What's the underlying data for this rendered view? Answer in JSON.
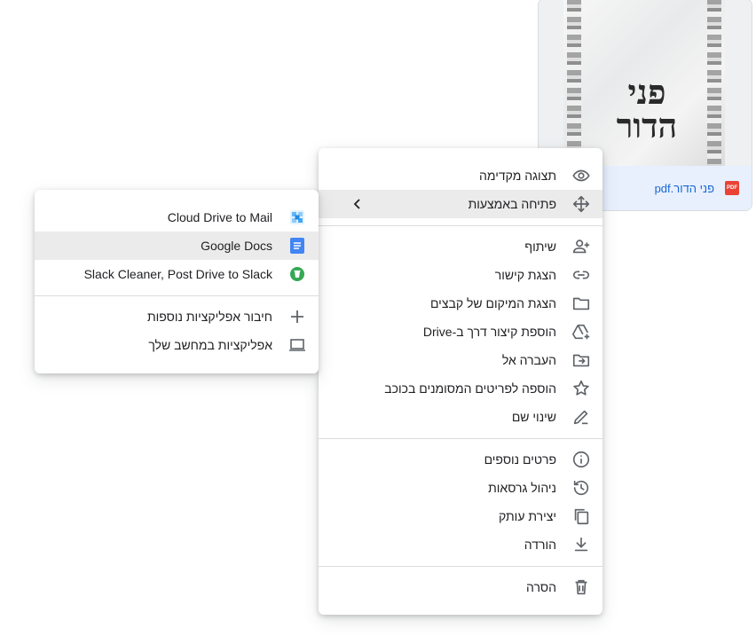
{
  "file": {
    "thumbnail_text": "פני הדור",
    "name": "פני הדור.pdf",
    "type_badge": "PDF",
    "icon": "pdf-icon",
    "accent": "#ea4335"
  },
  "main_menu": {
    "preview": "תצוגה מקדימה",
    "open_with": "פתיחה באמצעות",
    "share": "שיתוף",
    "get_link": "הצגת קישור",
    "show_location": "הצגת המיקום של קבצים",
    "add_shortcut": "הוספת קיצור דרך ב-Drive",
    "move_to": "העברה אל",
    "add_starred": "הוספה לפריטים המסומנים בכוכב",
    "rename": "שינוי שם",
    "details": "פרטים נוספים",
    "manage_versions": "ניהול גרסאות",
    "make_copy": "יצירת עותק",
    "download": "הורדה",
    "remove": "הסרה"
  },
  "open_with_menu": {
    "apps": [
      {
        "label": "Cloud Drive to Mail",
        "icon": "cloud-drive-to-mail-icon"
      },
      {
        "label": "Google Docs",
        "icon": "google-docs-icon"
      },
      {
        "label": "Slack Cleaner, Post Drive to Slack",
        "icon": "slack-cleaner-icon"
      }
    ],
    "connect_more": "חיבור אפליקציות נוספות",
    "computer_apps": "אפליקציות במחשב שלך"
  },
  "colors": {
    "highlight": "#ebebeb",
    "icon_gray": "#5f6368",
    "docs_blue": "#4285f4",
    "slack_green": "#34a853",
    "link_blue": "#1967d2"
  }
}
